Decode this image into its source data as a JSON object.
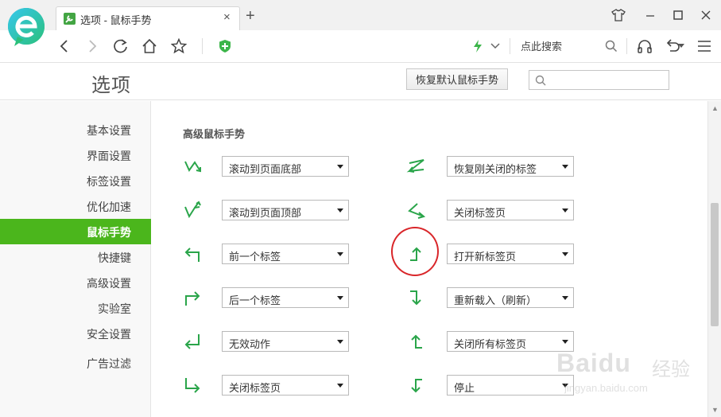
{
  "browser": {
    "tab_title": "选项 - 鼠标手势",
    "tab_close": "×",
    "new_tab": "+",
    "search_hint": "点此搜索"
  },
  "header": {
    "page_title": "选项",
    "restore_button": "恢复默认鼠标手势",
    "search_placeholder": ""
  },
  "sidebar": {
    "items": [
      {
        "label": "基本设置"
      },
      {
        "label": "界面设置"
      },
      {
        "label": "标签设置"
      },
      {
        "label": "优化加速"
      },
      {
        "label": "鼠标手势",
        "active": true
      },
      {
        "label": "快捷键"
      },
      {
        "label": "高级设置"
      },
      {
        "label": "实验室"
      },
      {
        "label": "安全设置"
      },
      {
        "label": "广告过滤"
      }
    ]
  },
  "gestures": {
    "section_title": "高级鼠标手势",
    "left": [
      {
        "icon": "down-up-down-zigzag-icon",
        "action": "滚动到页面底部"
      },
      {
        "icon": "up-down-up-zigzag-icon",
        "action": "滚动到页面顶部"
      },
      {
        "icon": "up-left-icon",
        "action": "前一个标签"
      },
      {
        "icon": "up-right-icon",
        "action": "后一个标签"
      },
      {
        "icon": "down-left-icon",
        "action": "无效动作"
      },
      {
        "icon": "down-right-icon",
        "action": "关闭标签页"
      }
    ],
    "right": [
      {
        "icon": "right-left-right-icon",
        "action": "恢复刚关闭的标签"
      },
      {
        "icon": "left-right-left-icon",
        "action": "关闭标签页"
      },
      {
        "icon": "right-up-icon",
        "action": "打开新标签页",
        "highlighted": true
      },
      {
        "icon": "right-down-icon",
        "action": "重新载入（刷新）"
      },
      {
        "icon": "up-icon-with-left-hook",
        "action": "关闭所有标签页"
      },
      {
        "icon": "down-icon-with-left-hook",
        "action": "停止"
      }
    ]
  },
  "colors": {
    "accent_green": "#4bb61c",
    "gesture_green": "#2aa54a",
    "annotation_red": "#d9262a"
  },
  "watermark": {
    "brand": "Baidu",
    "cn": "经验",
    "url": "jingyan.baidu.com"
  }
}
